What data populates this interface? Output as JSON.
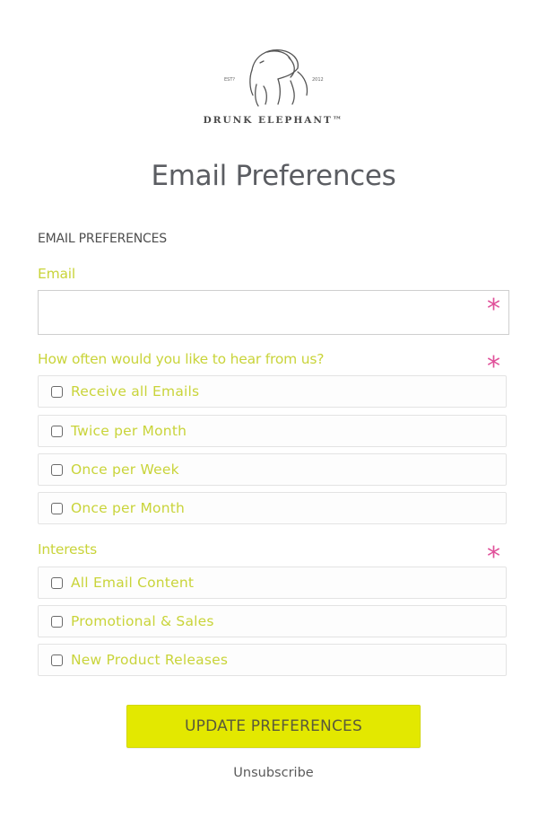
{
  "brand": {
    "name": "DRUNK ELEPHANT™",
    "est_left": "EST?",
    "est_right": "2012"
  },
  "page_title": "Email Preferences",
  "section_heading": "EMAIL PREFERENCES",
  "email": {
    "label": "Email",
    "value": "",
    "placeholder": "",
    "required_marker": "*"
  },
  "frequency": {
    "label": "How often would you like to hear from us?",
    "required_marker": "*",
    "options": [
      {
        "label": "Receive all Emails",
        "checked": false
      },
      {
        "label": "Twice per Month",
        "checked": false
      },
      {
        "label": "Once per Week",
        "checked": false
      },
      {
        "label": "Once per Month",
        "checked": false
      }
    ]
  },
  "interests": {
    "label": "Interests",
    "required_marker": "*",
    "options": [
      {
        "label": "All Email Content",
        "checked": false
      },
      {
        "label": "Promotional & Sales",
        "checked": false
      },
      {
        "label": "New Product Releases",
        "checked": false
      }
    ]
  },
  "actions": {
    "submit_label": "UPDATE PREFERENCES",
    "unsubscribe_label": "Unsubscribe"
  },
  "colors": {
    "accent_label": "#c9d43a",
    "required": "#e0519a",
    "button_bg": "#e3e800",
    "title": "#5b5d62"
  }
}
